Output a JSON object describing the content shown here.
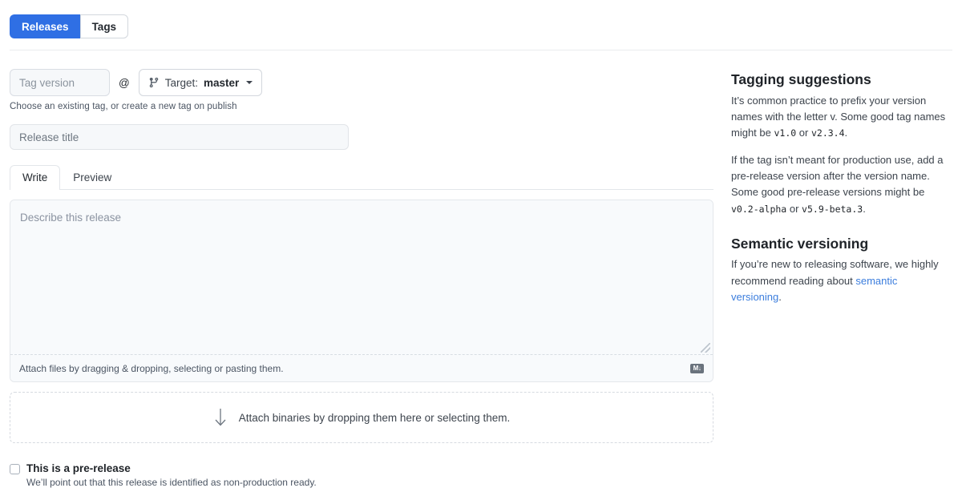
{
  "tabs": {
    "releases_label": "Releases",
    "tags_label": "Tags"
  },
  "form": {
    "tag_placeholder": "Tag version",
    "tag_value": "",
    "at_symbol": "@",
    "target_label": "Target:",
    "target_value": "master",
    "tag_hint": "Choose an existing tag, or create a new tag on publish",
    "title_placeholder": "Release title",
    "title_value": "",
    "write_tab": "Write",
    "preview_tab": "Preview",
    "body_placeholder": "Describe this release",
    "body_value": "",
    "attach_files_text": "Attach files by dragging & dropping, selecting or pasting them.",
    "markdown_badge": "M↓",
    "dropzone_text": "Attach binaries by dropping them here or selecting them.",
    "prerelease_title": "This is a pre-release",
    "prerelease_sub": "We’ll point out that this release is identified as non-production ready."
  },
  "sidebar": {
    "tagging_heading": "Tagging suggestions",
    "tagging_p1_a": "It’s common practice to prefix your version names with the letter v. Some good tag names might be ",
    "tagging_p1_code1": "v1.0",
    "tagging_p1_b": " or ",
    "tagging_p1_code2": "v2.3.4",
    "tagging_p1_c": ".",
    "tagging_p2_a": "If the tag isn’t meant for production use, add a pre-release version after the version name. Some good pre-release versions might be ",
    "tagging_p2_code1": "v0.2-alpha",
    "tagging_p2_b": " or ",
    "tagging_p2_code2": "v5.9-beta.3",
    "tagging_p2_c": ".",
    "semver_heading": "Semantic versioning",
    "semver_p_a": "If you’re new to releasing software, we highly recommend reading about ",
    "semver_link": "semantic versioning",
    "semver_p_b": "."
  },
  "colors": {
    "accent": "#2f6fe4",
    "link": "#3b7ddd",
    "border": "#d3d7dd",
    "field_bg": "#f6f8fa",
    "text": "#24292f",
    "muted": "#4b5563"
  },
  "icons": {
    "branch": "git-branch-icon",
    "caret": "chevron-down-icon",
    "arrow_down": "arrow-down-icon",
    "markdown": "markdown-icon"
  }
}
